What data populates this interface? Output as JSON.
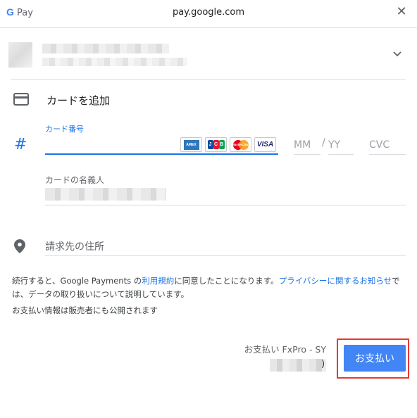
{
  "window": {
    "brand_g": "G",
    "brand_text": "Pay",
    "url": "pay.google.com",
    "close_glyph": "✕"
  },
  "account": {
    "icons": {
      "expand": "chevron-down-icon"
    }
  },
  "card_section": {
    "title": "カードを追加",
    "icon": "credit-card-icon",
    "number_label": "カード番号",
    "number_value": "",
    "brands": [
      "AMEX",
      "JCB",
      "MasterCard",
      "VISA"
    ],
    "mm_placeholder": "MM",
    "slash": "/",
    "yy_placeholder": "YY",
    "cvc_placeholder": "CVC",
    "holder_label": "カードの名義人"
  },
  "address": {
    "placeholder": "請求先の住所",
    "icon": "location-pin-icon"
  },
  "terms": {
    "prefix": "続行すると、Google Payments の",
    "terms_link": "利用規約",
    "middle": "に同意したことになります。",
    "privacy_link": "プライバシーに関するお知らせ",
    "suffix": "では、データの取り扱いについて説明しています。"
  },
  "disclosure": "お支払い情報は販売者にも公開されます",
  "merchant": {
    "label": "お支払い FxPro - SY",
    "price_suffix": ")"
  },
  "pay_button": {
    "label": "お支払い"
  },
  "colors": {
    "accent": "#1a73e8",
    "pay_button": "#4285f4",
    "highlight": "#e53935",
    "divider": "#dadce0"
  }
}
